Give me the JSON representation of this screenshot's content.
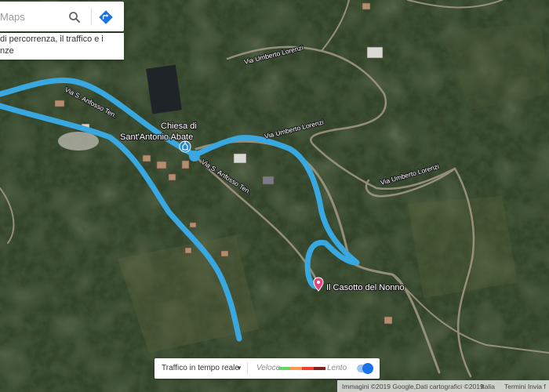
{
  "search": {
    "placeholder": "Maps"
  },
  "info_panel": {
    "line1": "di percorrenza, il traffico e i",
    "line2": "nze"
  },
  "roads": {
    "via_umberto_lorenzi": "Via Umberto Lorenzi",
    "via_s_anfosso_ten": "Via S. Anfosso Ten."
  },
  "places": {
    "church_line1": "Chiesa di",
    "church_line2": "Sant'Antonio Abate",
    "destination": "Il Casotto del Nonno"
  },
  "traffic": {
    "label": "Traffico in tempo reale",
    "fast": "Veloce",
    "slow": "Lento",
    "colors": [
      "#63d668",
      "#ff974d",
      "#f23c32",
      "#811f1f"
    ],
    "enabled": true
  },
  "footer": {
    "attribution": "Immagini ©2019 Google,Dati cartografici ©2019",
    "country": "Italia",
    "terms": "Termini",
    "send": "Invia f"
  },
  "colors": {
    "route": "#3aa8e0",
    "pin": "#e0457b",
    "accent": "#1a73e8"
  },
  "icons": [
    "search-icon",
    "directions-icon",
    "church-icon",
    "location-pin-icon",
    "caret-down-icon"
  ]
}
